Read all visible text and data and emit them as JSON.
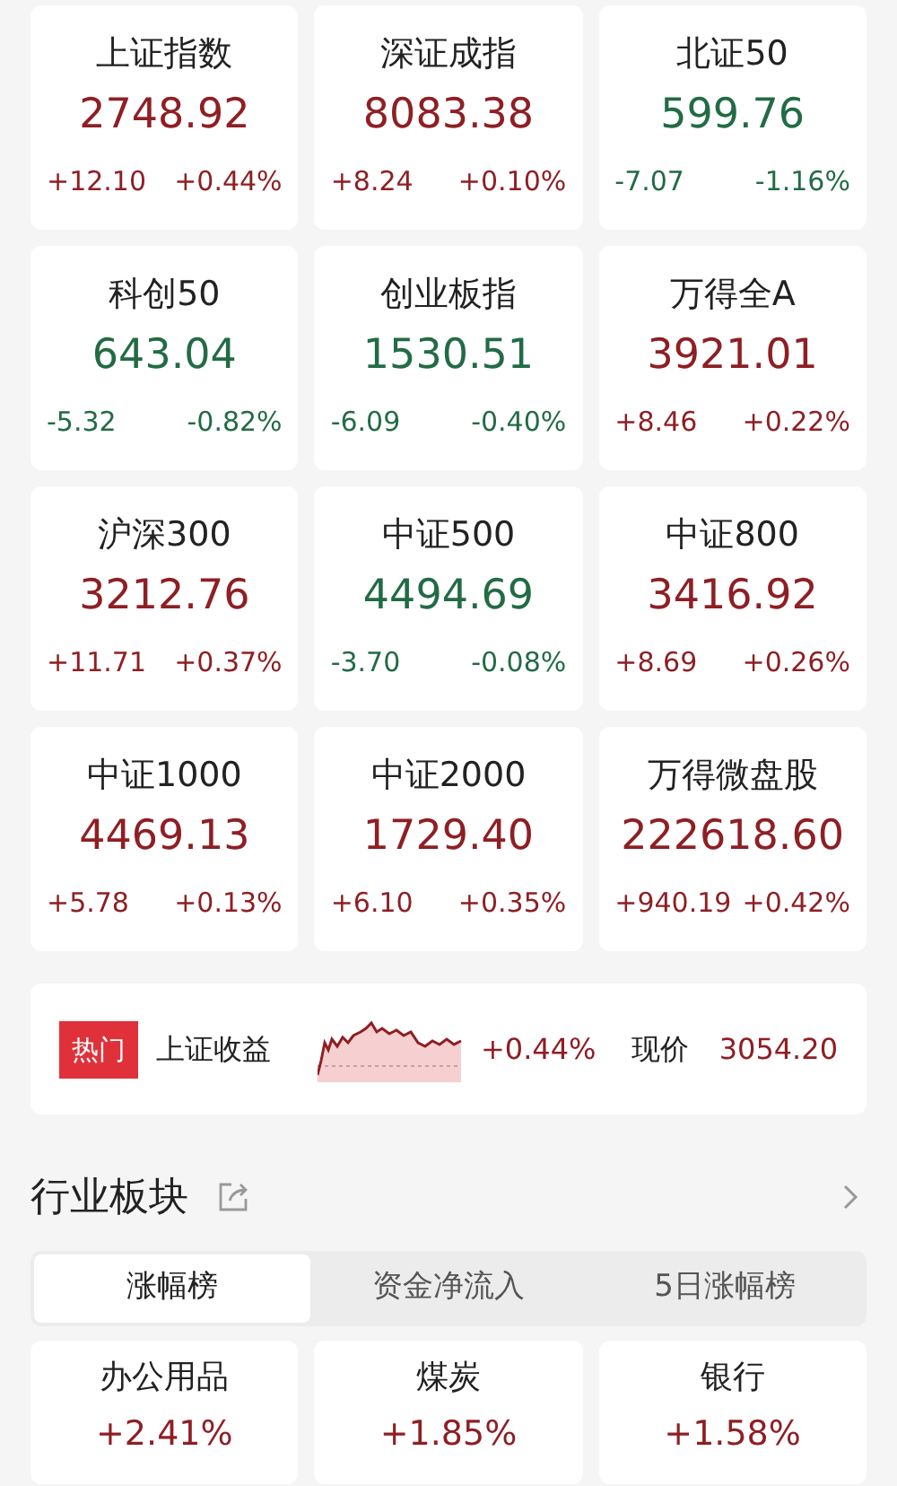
{
  "indices": [
    {
      "name": "上证指数",
      "price": "2748.92",
      "change": "+12.10",
      "percent": "+0.44%",
      "color": "#8e1f24"
    },
    {
      "name": "深证成指",
      "price": "8083.38",
      "change": "+8.24",
      "percent": "+0.10%",
      "color": "#8e1f24"
    },
    {
      "name": "北证50",
      "price": "599.76",
      "change": "-7.07",
      "percent": "-1.16%",
      "color": "#226b45"
    },
    {
      "name": "科创50",
      "price": "643.04",
      "change": "-5.32",
      "percent": "-0.82%",
      "color": "#226b45"
    },
    {
      "name": "创业板指",
      "price": "1530.51",
      "change": "-6.09",
      "percent": "-0.40%",
      "color": "#226b45"
    },
    {
      "name": "万得全A",
      "price": "3921.01",
      "change": "+8.46",
      "percent": "+0.22%",
      "color": "#8e1f24"
    },
    {
      "name": "沪深300",
      "price": "3212.76",
      "change": "+11.71",
      "percent": "+0.37%",
      "color": "#8e1f24"
    },
    {
      "name": "中证500",
      "price": "4494.69",
      "change": "-3.70",
      "percent": "-0.08%",
      "color": "#226b45"
    },
    {
      "name": "中证800",
      "price": "3416.92",
      "change": "+8.69",
      "percent": "+0.26%",
      "color": "#8e1f24"
    },
    {
      "name": "中证1000",
      "price": "4469.13",
      "change": "+5.78",
      "percent": "+0.13%",
      "color": "#8e1f24"
    },
    {
      "name": "中证2000",
      "price": "1729.40",
      "change": "+6.10",
      "percent": "+0.35%",
      "color": "#8e1f24"
    },
    {
      "name": "万得微盘股",
      "price": "222618.60",
      "change": "+940.19",
      "percent": "+0.42%",
      "color": "#8e1f24"
    }
  ],
  "hot_bar": {
    "tag": "热门",
    "name": "上证收益",
    "percent": "+0.44%",
    "price_label": "现价",
    "price": "3054.20"
  },
  "sector": {
    "title": "行业板块",
    "tabs": [
      {
        "label": "涨幅榜",
        "selected": true
      },
      {
        "label": "资金净流入",
        "selected": false
      },
      {
        "label": "5日涨幅榜",
        "selected": false
      }
    ],
    "items": [
      {
        "name": "办公用品",
        "percent": "+2.41%",
        "color": "#8e1f24"
      },
      {
        "name": "煤炭",
        "percent": "+1.85%",
        "color": "#8e1f24"
      },
      {
        "name": "银行",
        "percent": "+1.58%",
        "color": "#8e1f24"
      }
    ]
  }
}
